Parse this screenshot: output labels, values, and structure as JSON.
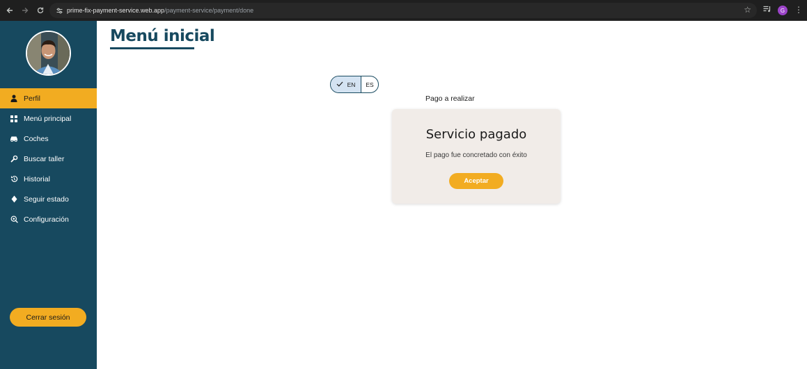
{
  "browser": {
    "url_host": "prime-fix-payment-service.web.app",
    "url_path": "/payment-service/payment/done",
    "profile_initial": "G"
  },
  "sidebar": {
    "items": [
      {
        "label": "Perfil",
        "icon": "person-icon",
        "active": true
      },
      {
        "label": "Menú principal",
        "icon": "grid-icon",
        "active": false
      },
      {
        "label": "Coches",
        "icon": "car-icon",
        "active": false
      },
      {
        "label": "Buscar taller",
        "icon": "wrench-icon",
        "active": false
      },
      {
        "label": "Historial",
        "icon": "history-icon",
        "active": false
      },
      {
        "label": "Seguir estado",
        "icon": "diamond-icon",
        "active": false
      },
      {
        "label": "Configuración",
        "icon": "settings-search-icon",
        "active": false
      }
    ],
    "logout_label": "Cerrar sesión"
  },
  "main": {
    "title": "Menú inicial",
    "language": {
      "en_label": "EN",
      "es_label": "ES",
      "selected": "EN"
    },
    "payment_label": "Pago a realizar",
    "card": {
      "title": "Servicio pagado",
      "message": "El pago fue concretado con éxito",
      "button_label": "Aceptar"
    }
  },
  "colors": {
    "sidebar_bg": "#17495f",
    "accent": "#f2ac21",
    "card_bg": "#f1ece8",
    "toggle_selected": "#d4e3f2"
  }
}
